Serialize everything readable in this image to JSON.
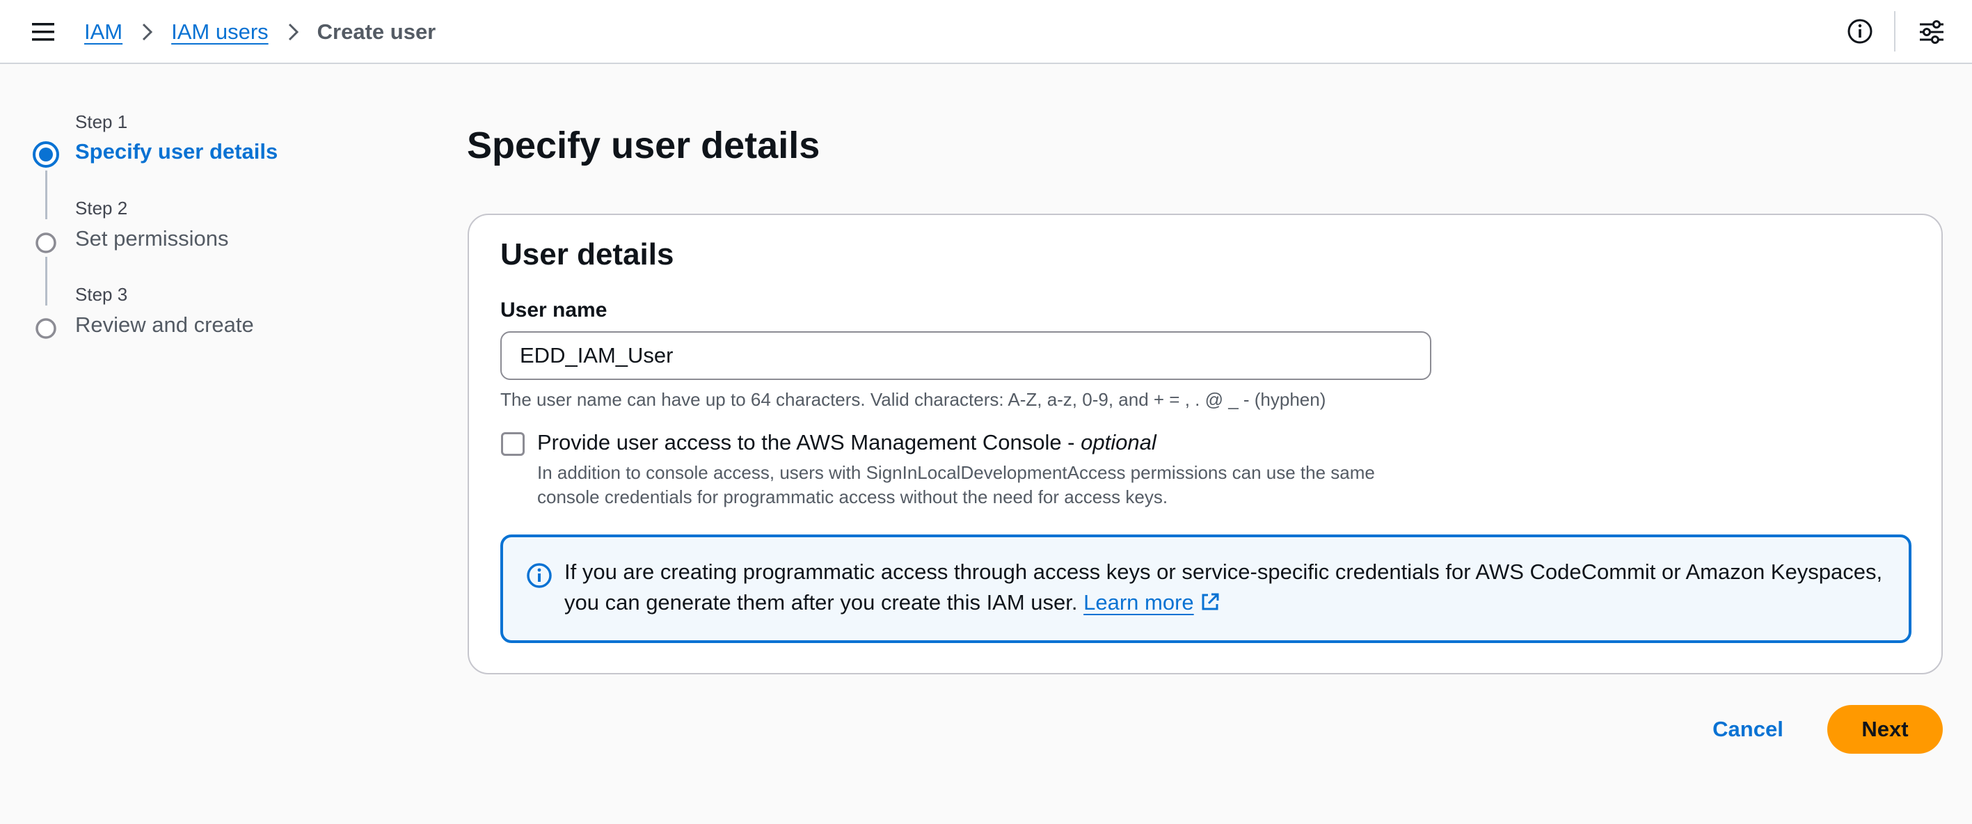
{
  "header": {
    "menu_icon": "hamburger-menu-icon",
    "breadcrumb": {
      "items": [
        {
          "label": "IAM"
        },
        {
          "label": "IAM users"
        },
        {
          "label": "Create user"
        }
      ]
    },
    "info_icon": "info-icon",
    "settings_icon": "split-panel-settings-icon"
  },
  "stepper": {
    "steps": [
      {
        "number_label": "Step 1",
        "title": "Specify user details",
        "state": "active"
      },
      {
        "number_label": "Step 2",
        "title": "Set permissions",
        "state": "pending"
      },
      {
        "number_label": "Step 3",
        "title": "Review and create",
        "state": "pending"
      }
    ]
  },
  "main": {
    "page_title": "Specify user details",
    "card": {
      "title": "User details",
      "username": {
        "label": "User name",
        "value": "EDD_IAM_User",
        "hint": "The user name can have up to 64 characters. Valid characters: A-Z, a-z, 0-9, and + = , . @ _ - (hyphen)"
      },
      "console_access": {
        "label": "Provide user access to the AWS Management Console - ",
        "optional": "optional",
        "checked": false,
        "description": "In addition to console access, users with SignInLocalDevelopmentAccess permissions can use the same console credentials for programmatic access without the need for access keys."
      },
      "alert": {
        "icon": "info-icon",
        "text": "If you are creating programmatic access through access keys or service-specific credentials for AWS CodeCommit or Amazon Keyspaces, you can generate them after you create this IAM user. ",
        "link_label": "Learn more",
        "link_icon": "external-link-icon"
      }
    }
  },
  "actions": {
    "cancel_label": "Cancel",
    "next_label": "Next"
  },
  "colors": {
    "accent": "#0972d3",
    "primary_button": "#ff9900",
    "alert_background": "#f2f8fd",
    "page_background": "#fafafa"
  }
}
